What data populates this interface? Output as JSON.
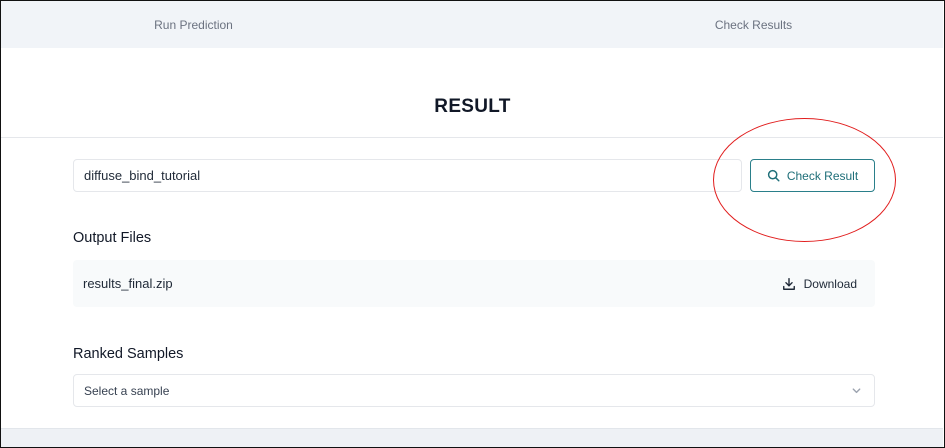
{
  "tabs": {
    "run_label": "Run Prediction",
    "check_label": "Check Results"
  },
  "page": {
    "title": "RESULT"
  },
  "job_input": {
    "value": "diffuse_bind_tutorial"
  },
  "check_button": {
    "label": "Check Result",
    "icon": "search-icon"
  },
  "output_files": {
    "heading": "Output Files",
    "files": [
      {
        "name": "results_final.zip",
        "action_label": "Download",
        "icon": "download-icon"
      }
    ]
  },
  "ranked_samples": {
    "heading": "Ranked Samples",
    "placeholder": "Select a sample",
    "icon": "chevron-down-icon"
  },
  "colors": {
    "accent": "#2a7f8a",
    "annotation": "#e11d1d",
    "tab_bar": "#f1f4f8"
  }
}
